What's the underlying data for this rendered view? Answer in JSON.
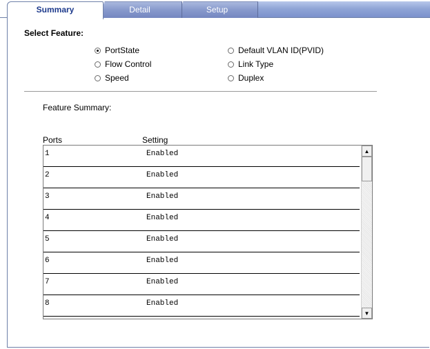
{
  "tabs": [
    {
      "label": "Summary"
    },
    {
      "label": "Detail"
    },
    {
      "label": "Setup"
    }
  ],
  "select_feature": {
    "label": "Select Feature:",
    "options": [
      {
        "label": "PortState",
        "selected": true
      },
      {
        "label": "Default VLAN ID(PVID)",
        "selected": false
      },
      {
        "label": "Flow Control",
        "selected": false
      },
      {
        "label": "Link Type",
        "selected": false
      },
      {
        "label": "Speed",
        "selected": false
      },
      {
        "label": "Duplex",
        "selected": false
      }
    ]
  },
  "summary": {
    "label": "Feature Summary:",
    "columns": {
      "ports": "Ports",
      "setting": "Setting"
    },
    "rows": [
      {
        "port": "1",
        "setting": "Enabled"
      },
      {
        "port": "2",
        "setting": "Enabled"
      },
      {
        "port": "3",
        "setting": "Enabled"
      },
      {
        "port": "4",
        "setting": "Enabled"
      },
      {
        "port": "5",
        "setting": "Enabled"
      },
      {
        "port": "6",
        "setting": "Enabled"
      },
      {
        "port": "7",
        "setting": "Enabled"
      },
      {
        "port": "8",
        "setting": "Enabled"
      }
    ]
  },
  "colors": {
    "tab_active_text": "#1d3a8c",
    "tab_bar": "#8fa4d6"
  }
}
